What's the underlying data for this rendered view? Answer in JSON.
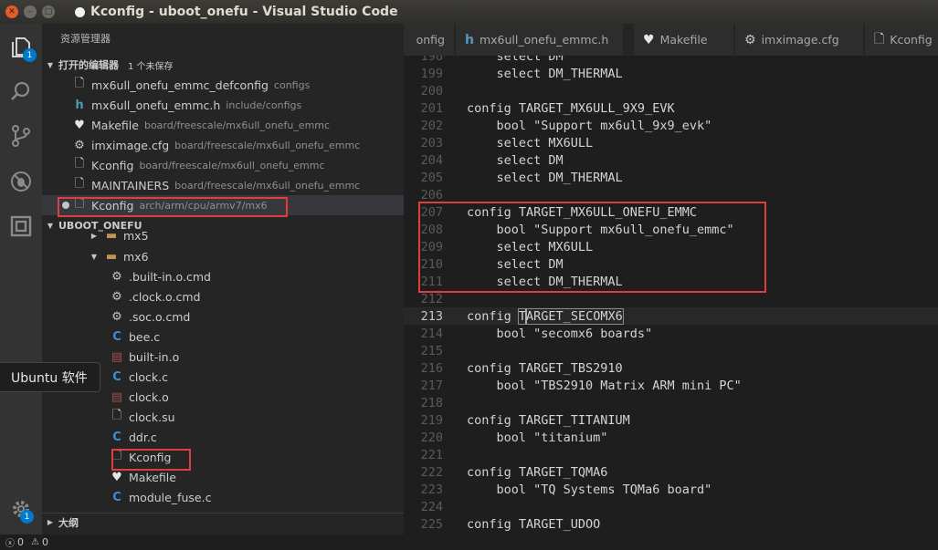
{
  "window": {
    "title": "Kconfig - uboot_onefu - Visual Studio Code"
  },
  "activity": {
    "explorer_badge": "1",
    "settings_badge": "1"
  },
  "sidebar": {
    "header": "资源管理器",
    "open_editors": {
      "title": "打开的编辑器",
      "unsaved": "1 个未保存",
      "items": [
        {
          "name": "mx6ull_onefu_emmc_defconfig",
          "path": "configs",
          "icon": "file-icon"
        },
        {
          "name": "mx6ull_onefu_emmc.h",
          "path": "include/configs",
          "icon": "h-file-icon"
        },
        {
          "name": "Makefile",
          "path": "board/freescale/mx6ull_onefu_emmc",
          "icon": "makefile-icon"
        },
        {
          "name": "imximage.cfg",
          "path": "board/freescale/mx6ull_onefu_emmc",
          "icon": "gear-icon"
        },
        {
          "name": "Kconfig",
          "path": "board/freescale/mx6ull_onefu_emmc",
          "icon": "file-icon"
        },
        {
          "name": "MAINTAINERS",
          "path": "board/freescale/mx6ull_onefu_emmc",
          "icon": "file-icon"
        },
        {
          "name": "Kconfig",
          "path": "arch/arm/cpu/armv7/mx6",
          "icon": "file-icon"
        }
      ]
    },
    "project": {
      "title": "UBOOT_ONEFU",
      "items": [
        {
          "name": "mx5",
          "icon": "folder-icon"
        },
        {
          "name": "mx6",
          "icon": "folder-open-icon"
        },
        {
          "name": ".built-in.o.cmd",
          "icon": "gear-icon"
        },
        {
          "name": ".clock.o.cmd",
          "icon": "gear-icon"
        },
        {
          "name": ".soc.o.cmd",
          "icon": "gear-icon"
        },
        {
          "name": "bee.c",
          "icon": "c-file-icon"
        },
        {
          "name": "built-in.o",
          "icon": "binary-file-icon"
        },
        {
          "name": "clock.c",
          "icon": "c-file-icon"
        },
        {
          "name": "clock.o",
          "icon": "binary-file-icon"
        },
        {
          "name": "clock.su",
          "icon": "file-icon"
        },
        {
          "name": "ddr.c",
          "icon": "c-file-icon"
        },
        {
          "name": "Kconfig",
          "icon": "file-icon"
        },
        {
          "name": "Makefile",
          "icon": "makefile-icon"
        },
        {
          "name": "module_fuse.c",
          "icon": "c-file-icon"
        }
      ]
    },
    "outline": {
      "title": "大纲"
    }
  },
  "tooltip": {
    "text": "Ubuntu 软件"
  },
  "tabs": [
    {
      "label": "onfig",
      "icon": "file-icon"
    },
    {
      "label": "mx6ull_onefu_emmc.h",
      "icon": "h-file-icon"
    },
    {
      "label": "Makefile",
      "icon": "makefile-icon"
    },
    {
      "label": "imximage.cfg",
      "icon": "gear-icon"
    },
    {
      "label": "Kconfig",
      "icon": "file-icon"
    }
  ],
  "editor": {
    "lines": [
      {
        "n": "198",
        "code": "    select DM"
      },
      {
        "n": "199",
        "code": "    select DM_THERMAL"
      },
      {
        "n": "200",
        "code": ""
      },
      {
        "n": "201",
        "code": "config TARGET_MX6ULL_9X9_EVK"
      },
      {
        "n": "202",
        "code": "    bool \"Support mx6ull_9x9_evk\""
      },
      {
        "n": "203",
        "code": "    select MX6ULL"
      },
      {
        "n": "204",
        "code": "    select DM"
      },
      {
        "n": "205",
        "code": "    select DM_THERMAL"
      },
      {
        "n": "206",
        "code": ""
      },
      {
        "n": "207",
        "code": "config TARGET_MX6ULL_ONEFU_EMMC"
      },
      {
        "n": "208",
        "code": "    bool \"Support mx6ull_onefu_emmc\""
      },
      {
        "n": "209",
        "code": "    select MX6ULL"
      },
      {
        "n": "210",
        "code": "    select DM"
      },
      {
        "n": "211",
        "code": "    select DM_THERMAL"
      },
      {
        "n": "212",
        "code": ""
      },
      {
        "n": "213",
        "code_prefix": "config ",
        "code_sel_a": "T",
        "code_sel_b": "ARGET_SECOMX6"
      },
      {
        "n": "214",
        "code": "    bool \"secomx6 boards\""
      },
      {
        "n": "215",
        "code": ""
      },
      {
        "n": "216",
        "code": "config TARGET_TBS2910"
      },
      {
        "n": "217",
        "code": "    bool \"TBS2910 Matrix ARM mini PC\""
      },
      {
        "n": "218",
        "code": ""
      },
      {
        "n": "219",
        "code": "config TARGET_TITANIUM"
      },
      {
        "n": "220",
        "code": "    bool \"titanium\""
      },
      {
        "n": "221",
        "code": ""
      },
      {
        "n": "222",
        "code": "config TARGET_TQMA6"
      },
      {
        "n": "223",
        "code": "    bool \"TQ Systems TQMa6 board\""
      },
      {
        "n": "224",
        "code": ""
      },
      {
        "n": "225",
        "code": "config TARGET_UDOO"
      }
    ]
  },
  "status": {
    "errors": "0",
    "warnings": "0"
  },
  "colors": {
    "accent": "#007acc",
    "highlight_box": "#e03e3e",
    "editor_bg": "#1e1e1e"
  }
}
